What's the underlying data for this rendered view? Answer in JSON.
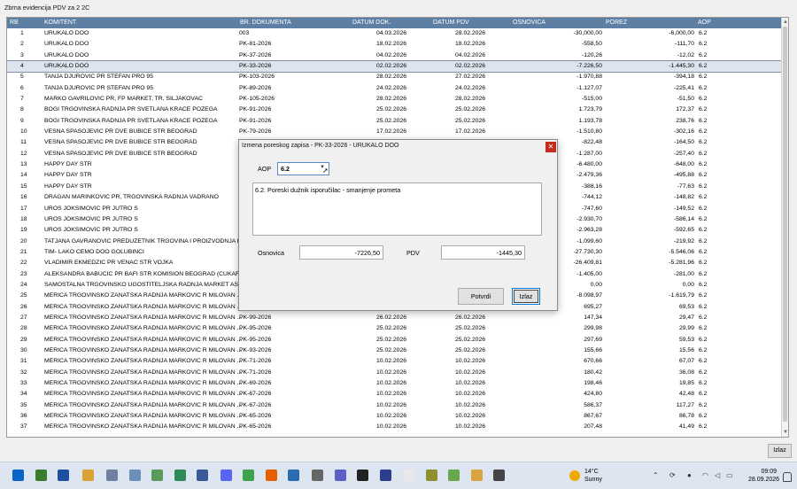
{
  "window": {
    "title": "Zbrna evidencija PDV za 2 2C"
  },
  "grid": {
    "columns": [
      "RB",
      "KOMITENT",
      "BR. DOKUMENTA",
      "DATUM DOK.",
      "DATUM PDV",
      "OSNOVICA",
      "POREZ",
      "AOP"
    ],
    "selected_row": 3,
    "rows": [
      [
        "1",
        "URUKALO DOO",
        "003",
        "04.03.2026",
        "28.02.2026",
        "-30,000,00",
        "-6,000,00",
        "6.2"
      ],
      [
        "2",
        "URUKALO DOO",
        "PK-81-2026",
        "18.02.2026",
        "18.02.2026",
        "-558,50",
        "-111,70",
        "6.2"
      ],
      [
        "3",
        "URUKALO DOO",
        "PK-37-2026",
        "04.02.2026",
        "04.02.2026",
        "-120,26",
        "-12,02",
        "6.2"
      ],
      [
        "4",
        "URUKALO DOO",
        "PK-33-2026",
        "02.02.2026",
        "02.02.2026",
        "-7.226,50",
        "-1.445,30",
        "6.2"
      ],
      [
        "5",
        "TANJA DJUROVIC PR STEFAN PRO 95",
        "PK-103-2026",
        "28.02.2026",
        "27.02.2026",
        "-1.970,88",
        "-394,18",
        "6.2"
      ],
      [
        "6",
        "TANJA DJUROVIC PR STEFAN PRO 95",
        "PK-89-2026",
        "24.02.2026",
        "24.02.2026",
        "-1.127,07",
        "-225,41",
        "6.2"
      ],
      [
        "7",
        "MARKO GAVRILOVIC PR, FP MARKET, TR, SILJAKOVAC",
        "PK-105-2026",
        "28.02.2026",
        "28.02.2026",
        "-515,00",
        "-51,50",
        "6.2"
      ],
      [
        "8",
        "BOGI TRGOVINSKA RADNJA PR SVETLANA KRACE POZEGA",
        "PK-91-2026",
        "25.02.2026",
        "25.02.2026",
        "1.723,79",
        "172,37",
        "6.2"
      ],
      [
        "9",
        "BOGI TRGOVINSKA RADNJA PR SVETLANA KRACE POZEGA",
        "PK-91-2026",
        "25.02.2026",
        "25.02.2026",
        "1.193,78",
        "238,76",
        "6.2"
      ],
      [
        "10",
        "VESNA SPASOJEVIC PR DVE BUBICE STR BEOGRAD",
        "PK-79-2026",
        "17.02.2026",
        "17.02.2026",
        "-1.510,80",
        "-302,16",
        "6.2"
      ],
      [
        "11",
        "VESNA SPASOJEVIC PR DVE BUBICE STR BEOGRAD",
        "",
        "",
        "",
        "-822,48",
        "-164,50",
        "6.2"
      ],
      [
        "12",
        "VESNA SPASOJEVIC PR DVE BUBICE STR BEOGRAD",
        "",
        "",
        "",
        "-1.287,00",
        "-257,40",
        "6.2"
      ],
      [
        "13",
        "HAPPY DAY STR",
        "",
        "",
        "",
        "-6.480,00",
        "-648,00",
        "6.2"
      ],
      [
        "14",
        "HAPPY DAY STR",
        "",
        "",
        "",
        "-2.479,36",
        "-495,88",
        "6.2"
      ],
      [
        "15",
        "HAPPY DAY STR",
        "",
        "",
        "",
        "-388,16",
        "-77,63",
        "6.2"
      ],
      [
        "16",
        "DRAGAN MARINKOVIĆ PR, TRGOVINSKA RADNJA VADRANO",
        "",
        "",
        "",
        "-744,12",
        "-148,82",
        "6.2"
      ],
      [
        "17",
        "UROŠ JOKSIMOVIĆ PR JUTRO S",
        "",
        "",
        "",
        "-747,60",
        "-149,52",
        "6.2"
      ],
      [
        "18",
        "UROŠ JOKSIMOVIĆ PR JUTRO S",
        "",
        "",
        "",
        "-2.930,70",
        "-586,14",
        "6.2"
      ],
      [
        "19",
        "UROŠ JOKSIMOVIĆ PR JUTRO S",
        "",
        "",
        "",
        "-2.963,28",
        "-592,65",
        "6.2"
      ],
      [
        "20",
        "TATJANA GAVRANOVIĆ PREDUZETNIK TRGOVINA I PROIZVODNJA K...",
        "",
        "",
        "",
        "-1.099,60",
        "-219,92",
        "6.2"
      ],
      [
        "21",
        "TIM- LAKO ĆEMO DOO GOLUBINCI",
        "",
        "",
        "",
        "-27.730,30",
        "-5.546,06",
        "6.2"
      ],
      [
        "22",
        "VLADIMIR EKMEDZIC PR VENAC STR VOJKA",
        "",
        "",
        "",
        "-26.409,81",
        "-5.281,96",
        "6.2"
      ],
      [
        "23",
        "ALEKSANDRA BABUCIC PR BAFI STR KOMISION BEOGRAD (CUKARI...",
        "",
        "",
        "",
        "-1.405,00",
        "-281,00",
        "6.2"
      ],
      [
        "24",
        "SAMOSTALNA TRGOVINSKO UGOSTITELJSKA RADNJA MARKET AS ...",
        "",
        "",
        "",
        "0,00",
        "0,00",
        "6.2"
      ],
      [
        "25",
        "MERICA TRGOVINSKO ZANATSKA RADNJA MARKOVIC R MILOVAN ...",
        "",
        "",
        "",
        "-8.098,97",
        "-1.619,79",
        "6.2"
      ],
      [
        "26",
        "MERICA TRGOVINSKO ZANATSKA RADNJA MARKOVIC R MILOVAN ...",
        "",
        "",
        "",
        "695,27",
        "69,53",
        "6.2"
      ],
      [
        "27",
        "MERICA TRGOVINSKO ZANATSKA RADNJA MARKOVIC R MILOVAN ...",
        "PK-99-2026",
        "26.02.2026",
        "26.02.2026",
        "147,34",
        "29,47",
        "6.2"
      ],
      [
        "28",
        "MERICA TRGOVINSKO ZANATSKA RADNJA MARKOVIC R MILOVAN ...",
        "PK-95-2026",
        "25.02.2026",
        "25.02.2026",
        "299,98",
        "29,99",
        "6.2"
      ],
      [
        "29",
        "MERICA TRGOVINSKO ZANATSKA RADNJA MARKOVIC R MILOVAN ...",
        "PK-95-2026",
        "25.02.2026",
        "25.02.2026",
        "297,69",
        "59,53",
        "6.2"
      ],
      [
        "30",
        "MERICA TRGOVINSKO ZANATSKA RADNJA MARKOVIC R MILOVAN ...",
        "PK-93-2026",
        "25.02.2026",
        "25.02.2026",
        "155,66",
        "15,56",
        "6.2"
      ],
      [
        "31",
        "MERICA TRGOVINSKO ZANATSKA RADNJA MARKOVIC R MILOVAN ...",
        "PK-71-2026",
        "10.02.2026",
        "10.02.2026",
        "670,66",
        "67,07",
        "6.2"
      ],
      [
        "32",
        "MERICA TRGOVINSKO ZANATSKA RADNJA MARKOVIC R MILOVAN ...",
        "PK-71-2026",
        "10.02.2026",
        "10.02.2026",
        "180,42",
        "36,08",
        "6.2"
      ],
      [
        "33",
        "MERICA TRGOVINSKO ZANATSKA RADNJA MARKOVIC R MILOVAN ...",
        "PK-69-2026",
        "10.02.2026",
        "10.02.2026",
        "198,46",
        "19,85",
        "6.2"
      ],
      [
        "34",
        "MERICA TRGOVINSKO ZANATSKA RADNJA MARKOVIC R MILOVAN ...",
        "PK-67-2026",
        "10.02.2026",
        "10.02.2026",
        "424,80",
        "42,48",
        "6.2"
      ],
      [
        "35",
        "MERICA TRGOVINSKO ZANATSKA RADNJA MARKOVIC R MILOVAN ...",
        "PK-67-2026",
        "10.02.2026",
        "10.02.2026",
        "586,37",
        "117,27",
        "6.2"
      ],
      [
        "36",
        "MERICA TRGOVINSKO ZANATSKA RADNJA MARKOVIC R MILOVAN ...",
        "PK-65-2026",
        "10.02.2026",
        "10.02.2026",
        "867,67",
        "86,78",
        "6.2"
      ],
      [
        "37",
        "MERICA TRGOVINSKO ZANATSKA RADNJA MARKOVIC R MILOVAN ...",
        "PK-65-2026",
        "10.02.2026",
        "10.02.2026",
        "207,48",
        "41,49",
        "6.2"
      ]
    ]
  },
  "dialog": {
    "title": "Izmena poreskog zapisa - PK-33-2026 - URUKALO DOO",
    "close_glyph": "✕",
    "aop_label": "AOP",
    "aop_value": "6.2",
    "description": "6.2. Poreski dužnik isporučilac - smanjenje prometa",
    "osnovica_label": "Osnovica",
    "osnovica_value": "-7226,50",
    "pdv_label": "PDV",
    "pdv_value": "-1445,30",
    "confirm_label": "Potvrdi",
    "exit_label": "Izlaz"
  },
  "main_exit_label": "Izlaz",
  "taskbar": {
    "icons": [
      "windows-start-icon",
      "app-icon",
      "save-icon",
      "folder-icon",
      "database-icon",
      "mail-icon",
      "notepad-icon",
      "spreadsheet-icon",
      "user-app-icon",
      "ms-chat-icon",
      "chat-icon",
      "firefox-icon",
      "ms-icon",
      "tools-icon",
      "teams-icon",
      "github-icon",
      "media-icon",
      "document-icon",
      "archive-icon",
      "download-icon",
      "explorer-icon",
      "terminal-icon"
    ],
    "weather_temp": "14°C",
    "weather_text": "Sunny",
    "time": "09:09",
    "date": "28.09.2026"
  }
}
